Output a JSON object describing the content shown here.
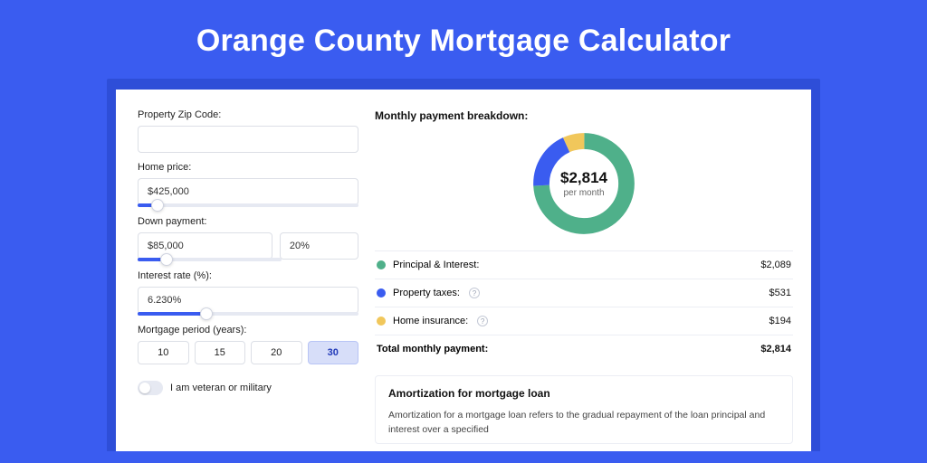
{
  "title": "Orange County Mortgage Calculator",
  "colors": {
    "principal": "#4fb08a",
    "taxes": "#3a5cf0",
    "insurance": "#f1c75b"
  },
  "form": {
    "zip": {
      "label": "Property Zip Code:",
      "value": ""
    },
    "price": {
      "label": "Home price:",
      "value": "$425,000",
      "slider_pct": 9
    },
    "down": {
      "label": "Down payment:",
      "amount": "$85,000",
      "percent": "20%",
      "slider_pct": 20
    },
    "rate": {
      "label": "Interest rate (%):",
      "value": "6.230%",
      "slider_pct": 31
    },
    "period": {
      "label": "Mortgage period (years):",
      "options": [
        "10",
        "15",
        "20",
        "30"
      ],
      "selected": "30"
    },
    "veteran_label": "I am veteran or military",
    "veteran_on": false
  },
  "breakdown": {
    "title": "Monthly payment breakdown:",
    "center_amount": "$2,814",
    "center_sub": "per month",
    "rows": [
      {
        "key": "principal",
        "label": "Principal & Interest:",
        "value": "$2,089",
        "info": false
      },
      {
        "key": "taxes",
        "label": "Property taxes:",
        "value": "$531",
        "info": true
      },
      {
        "key": "insurance",
        "label": "Home insurance:",
        "value": "$194",
        "info": true
      }
    ],
    "total_label": "Total monthly payment:",
    "total_value": "$2,814"
  },
  "chart_data": {
    "type": "pie",
    "title": "Monthly payment breakdown",
    "series": [
      {
        "name": "Principal & Interest",
        "value": 2089
      },
      {
        "name": "Property taxes",
        "value": 531
      },
      {
        "name": "Home insurance",
        "value": 194
      }
    ],
    "total": 2814,
    "unit": "USD per month"
  },
  "amortization": {
    "title": "Amortization for mortgage loan",
    "body": "Amortization for a mortgage loan refers to the gradual repayment of the loan principal and interest over a specified"
  }
}
